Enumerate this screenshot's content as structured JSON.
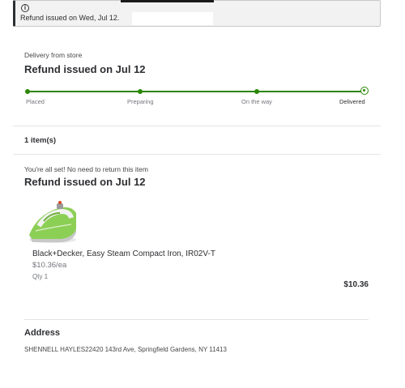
{
  "alert": {
    "icon": "info-icon",
    "message": "Refund issued on Wed, Jul 12."
  },
  "delivery": {
    "method": "Delivery from store",
    "status_heading": "Refund issued on Jul 12",
    "steps": [
      {
        "label": "Placed",
        "done": true
      },
      {
        "label": "Preparing",
        "done": true
      },
      {
        "label": "On the way",
        "done": true
      },
      {
        "label": "Delivered",
        "done": true,
        "current": true
      }
    ],
    "accent_color": "#2a8703"
  },
  "items": {
    "count_label": "1 item(s)",
    "return_note": "You're all set! No need to return this item",
    "refund_heading": "Refund issued on Jul 12",
    "list": [
      {
        "image_icon": "steam-iron-product-image",
        "name": "Black+Decker, Easy Steam Compact Iron, IR02V-T",
        "unit_price": "$10.36/ea",
        "qty": "Qty 1",
        "total": "$10.36"
      }
    ]
  },
  "address": {
    "title": "Address",
    "text": "SHENNELL HAYLES22420 143rd Ave, Springfield Gardens, NY 11413"
  }
}
